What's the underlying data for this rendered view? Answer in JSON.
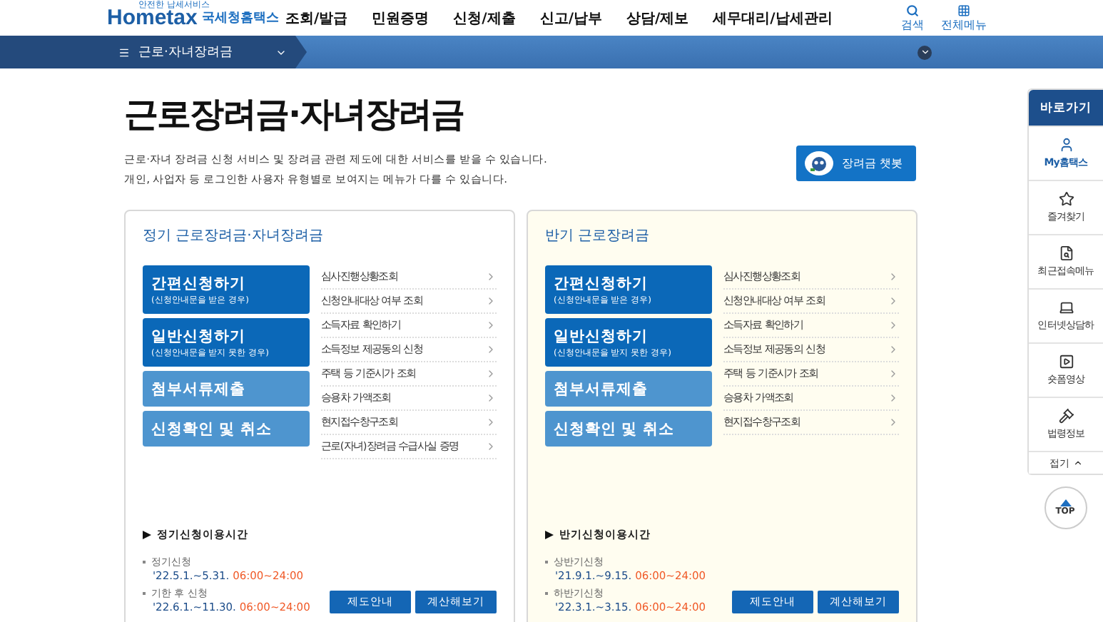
{
  "header": {
    "logo": {
      "small": "안전한 납세서비스",
      "brand": "Hometax",
      "suffix": "국세청홈택스"
    },
    "nav": [
      "조회/발급",
      "민원증명",
      "신청/제출",
      "신고/납부",
      "상담/제보",
      "세무대리/납세관리"
    ],
    "tools": [
      {
        "kind": "search",
        "label": "검색"
      },
      {
        "kind": "menu",
        "label": "전체메뉴"
      }
    ]
  },
  "breadcrumb": {
    "label": "근로·자녀장려금"
  },
  "page": {
    "title": "근로장려금·자녀장려금",
    "description": [
      "근로·자녀 장려금 신청 서비스 및 장려금 관련 제도에 대한 서비스를 받을 수 있습니다.",
      "개인, 사업자 등 로그인한 사용자 유형별로 보여지는 메뉴가 다를 수 있습니다."
    ],
    "chatbot": "장려금 챗봇"
  },
  "cards": [
    {
      "title": "정기 근로장려금·자녀장려금",
      "highlighted": false,
      "actions": [
        {
          "kind": "primary",
          "label": "간편신청하기",
          "sub": "(신청안내문을 받은 경우)"
        },
        {
          "kind": "primary",
          "label": "일반신청하기",
          "sub": "(신청안내문을 받지 못한 경우)"
        },
        {
          "kind": "secondary",
          "label": "첨부서류제출"
        },
        {
          "kind": "secondary",
          "label": "신청확인 및 취소"
        }
      ],
      "links": [
        "심사진행상황조회",
        "신청안내대상 여부 조회",
        "소득자료 확인하기",
        "소득정보 제공동의 신청",
        "주택 등 기준시가 조회",
        "승용차 가액조회",
        "현지접수창구조회",
        "근로(자녀)장려금 수급사실 증명"
      ],
      "hours_title": "정기신청이용시간",
      "hours": [
        {
          "label": "정기신청",
          "dates": "'22.5.1.~5.31.",
          "time": "06:00~24:00"
        },
        {
          "label": "기한 후 신청",
          "dates": "'22.6.1.~11.30.",
          "time": "06:00~24:00"
        }
      ],
      "buttons": [
        "제도안내",
        "계산해보기"
      ]
    },
    {
      "title": "반기 근로장려금",
      "highlighted": true,
      "actions": [
        {
          "kind": "primary",
          "label": "간편신청하기",
          "sub": "(신청안내문을 받은 경우)"
        },
        {
          "kind": "primary",
          "label": "일반신청하기",
          "sub": "(신청안내문을 받지 못한 경우)"
        },
        {
          "kind": "secondary",
          "label": "첨부서류제출"
        },
        {
          "kind": "secondary",
          "label": "신청확인 및 취소"
        }
      ],
      "links": [
        "심사진행상황조회",
        "신청안내대상 여부 조회",
        "소득자료 확인하기",
        "소득정보 제공동의 신청",
        "주택 등 기준시가 조회",
        "승용차 가액조회",
        "현지접수창구조회"
      ],
      "hours_title": "반기신청이용시간",
      "hours": [
        {
          "label": "상반기신청",
          "dates": "'21.9.1.~9.15.",
          "time": "06:00~24:00"
        },
        {
          "label": "하반기신청",
          "dates": "'22.3.1.~3.15.",
          "time": "06:00~24:00"
        }
      ],
      "buttons": [
        "제도안내",
        "계산해보기"
      ]
    }
  ],
  "quick": {
    "title": "바로가기",
    "items": [
      {
        "kind": "user",
        "label": "My홈택스",
        "selected": true
      },
      {
        "kind": "star",
        "label": "즐겨찾기",
        "selected": false
      },
      {
        "kind": "recent",
        "label": "최근접속메뉴",
        "selected": false
      },
      {
        "kind": "chat",
        "label": "인터넷상담하",
        "selected": false
      },
      {
        "kind": "video",
        "label": "숏폼영상",
        "selected": false
      },
      {
        "kind": "law",
        "label": "법령정보",
        "selected": false
      }
    ],
    "collapse": "접기",
    "top": "TOP"
  }
}
